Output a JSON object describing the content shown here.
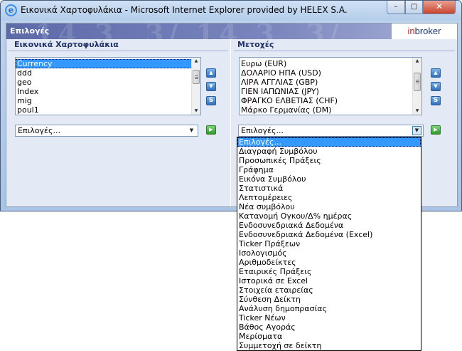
{
  "window": {
    "title": "Εικονικά Χαρτοφυλάκια - Microsoft Internet Explorer provided by HELEX S.A.",
    "ie_icon_glyph": "e",
    "minimize_glyph": "–",
    "maximize_glyph": "□",
    "close_glyph": "✕"
  },
  "banner": {
    "title": "Επιλογές",
    "deco_text": "14.3. 3/ 14.3. 3/",
    "logo_in": "in",
    "logo_broker": "broker",
    "logo_accent": "#d42020"
  },
  "left_panel": {
    "heading": "Εικονικά Χαρτοφυλάκια",
    "items": [
      "Currency",
      "ddd",
      "geo",
      "Index",
      "mig",
      "poul1"
    ],
    "selected_index": 0,
    "select_value": "Επιλογές..."
  },
  "right_panel": {
    "heading": "Μετοχές",
    "items": [
      "Ευρω (EUR)",
      "ΔΟΛΑΡΙΟ ΗΠΑ (USD)",
      "ΛΙΡΑ ΑΓΓΛΙΑΣ (GBP)",
      "ΓΙΕΝ ΙΑΠΩΝΙΑΣ (JPY)",
      "ΦΡΑΓΚΟ ΕΛΒΕΤΙΑΣ (CHF)",
      "Μάρκο Γερμανίας (DM)"
    ],
    "select_value": "Επιλογές..."
  },
  "side_buttons": {
    "up_glyph": "▲",
    "down_glyph": "▼",
    "s_glyph": "S",
    "go_glyph": "▶"
  },
  "dropdown": {
    "selected_index": 0,
    "options": [
      "Επιλογές...",
      "Διαγραφή Συμβόλου",
      "Προσωπικές Πράξεις",
      "Γράφημα",
      "Εικόνα Συμβόλου",
      "Στατιστικά",
      "Λεπτομέρειες",
      "Νέα συμβόλου",
      "Κατανομή Ογκου/Δ% ημέρας",
      "Ενδοσυνεδριακά Δεδομένα",
      "Ενδοσυνεδριακά Δεδομένα (Excel)",
      "Ticker Πράξεων",
      "Ισολογισμός",
      "Αριθμοδείκτες",
      "Εταιρικές Πράξεις",
      "Ιστορικά σε Excel",
      "Στοιχεία εταιρείας",
      "Σύνθεση Δείκτη",
      "Ανάλυση δημοπρασίας",
      "Ticker Νέων",
      "Βάθος Αγοράς",
      "Μερίσματα",
      "Συμμετοχή σε δείκτη"
    ]
  }
}
